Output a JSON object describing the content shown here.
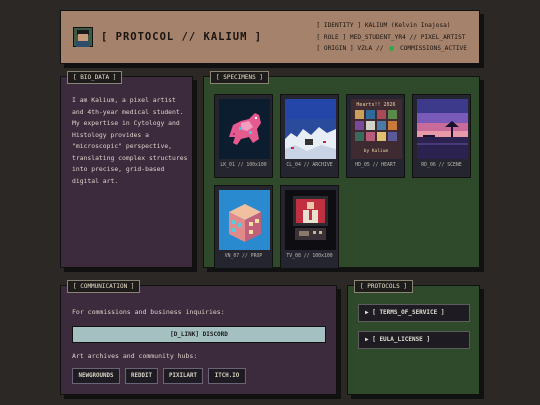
{
  "header": {
    "title": "[ PROTOCOL // KALIUM ]",
    "meta": {
      "row1": "[ IDENTITY ] KALIUM (Kelvin Inajosa)",
      "row2": "[ ROLE ] MED_STUDENT_YR4 // PIXEL_ARTIST",
      "row3_prefix": "[ ORIGIN ] VZLA //",
      "row3_status": "COMMISSIONS_ACTIVE"
    }
  },
  "bio": {
    "tag": "[ BIO_DATA ]",
    "text": "I am Kalium, a pixel artist and 4th-year medical student. My expertise in Cytology and Histology provides a \"microscopic\" perspective, translating complex structures into precise, grid-based digital art."
  },
  "specimens": {
    "tag": "[ SPECIMENS ]",
    "items": [
      {
        "caption": "LK_01 // 100x100"
      },
      {
        "caption": "CL_04 // ARCHIVE"
      },
      {
        "caption": "HD_05 // HEART"
      },
      {
        "caption": "RD_06 // SCENE"
      },
      {
        "caption": "VN_07 // PROP"
      },
      {
        "caption": "TV_08 // 100x100"
      }
    ],
    "thumb_text": {
      "heart_header": "Hearts!! 2026",
      "heart_footer": "by Kalium"
    }
  },
  "communication": {
    "tag": "[ COMMUNICATION ]",
    "inquiry_text": "For commissions and business inquiries:",
    "discord_label": "[D_LINK] DISCORD",
    "archives_text": "Art archives and community hubs:",
    "hubs": [
      "NEWGROUNDS",
      "REDDIT",
      "PIXILART",
      "ITCH.IO"
    ]
  },
  "protocols": {
    "tag": "[ PROTOCOLS ]",
    "items": [
      "▶ [ TERMS_OF_SERVICE ]",
      "▶ [ EULA_LICENSE ]"
    ]
  },
  "colors": {
    "background": "#2b2825",
    "header": "#a5826b",
    "purple_panel": "#3c2a3d",
    "green_panel": "#2f4a2b",
    "discord_button": "#a4c0c1",
    "status_active": "#2fa84f"
  }
}
